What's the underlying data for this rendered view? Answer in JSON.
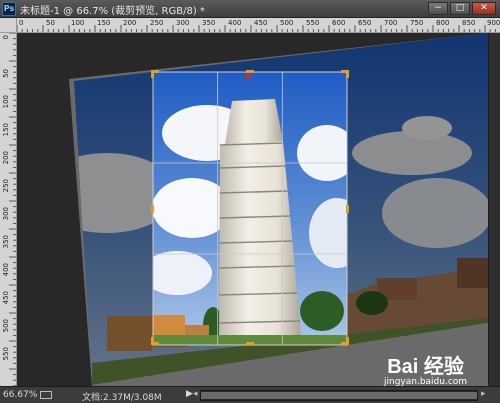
{
  "window": {
    "app_icon": "Ps",
    "title": "未标题-1 @ 66.7% (裁剪预览, RGB/8) *",
    "buttons": {
      "minimize": "−",
      "maximize": "□",
      "close": "✕"
    }
  },
  "rulers": {
    "top": [
      "0",
      "50",
      "100",
      "150",
      "200",
      "250",
      "300",
      "350",
      "400",
      "450",
      "500",
      "550",
      "600",
      "650",
      "700",
      "750",
      "800",
      "850",
      "900"
    ],
    "left": [
      "0",
      "50",
      "100",
      "150",
      "200",
      "250",
      "300",
      "350",
      "400",
      "450",
      "500",
      "550"
    ]
  },
  "status": {
    "zoom": "66.67%",
    "doc_size": "文档:2.37M/3.08M",
    "arrow": "▶"
  },
  "watermark": {
    "brand": "Bai 经验",
    "url": "jingyan.baidu.com"
  },
  "colors": {
    "crop_handle": "#e0a020",
    "grid_line": "#c8c8c8"
  }
}
